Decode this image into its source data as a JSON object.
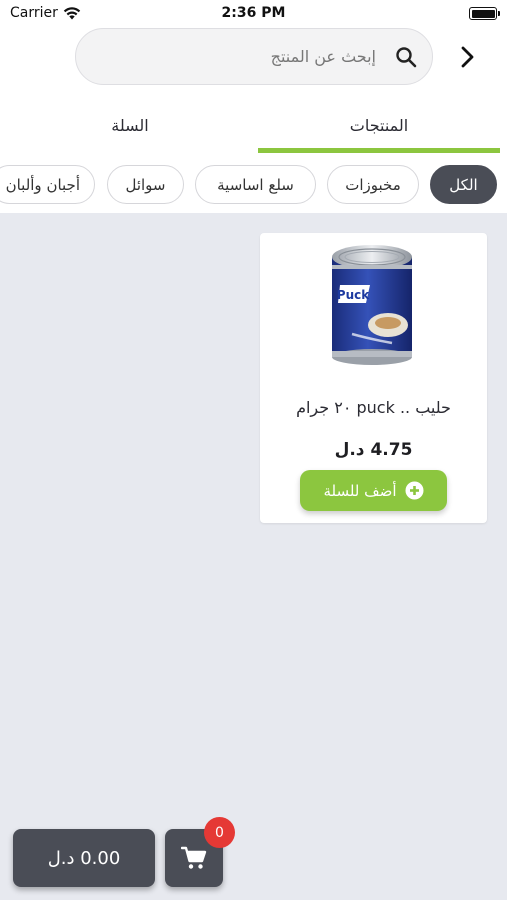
{
  "status_bar": {
    "carrier": "Carrier",
    "time": "2:36 PM"
  },
  "search": {
    "placeholder": "إبحث عن المنتج",
    "value": ""
  },
  "tabs": [
    {
      "label": "المنتجات",
      "active": true
    },
    {
      "label": "السلة",
      "active": false
    }
  ],
  "categories": [
    {
      "label": "الكل",
      "active": true
    },
    {
      "label": "مخبوزات",
      "active": false
    },
    {
      "label": "سلع اساسية",
      "active": false
    },
    {
      "label": "سوائل",
      "active": false
    },
    {
      "label": "أجبان وألبان",
      "active": false
    }
  ],
  "products": [
    {
      "name": "حليب .. puck ٢٠ جرام",
      "price": "4.75 د.ل",
      "add_label": "أضف للسلة",
      "image_text": "Puck"
    }
  ],
  "footer": {
    "total": "0.00 د.ل",
    "cart_count": "0"
  },
  "colors": {
    "accent": "#8cc63f",
    "dark": "#4a4d56",
    "badge": "#e53935",
    "background": "#e7e9ef"
  }
}
